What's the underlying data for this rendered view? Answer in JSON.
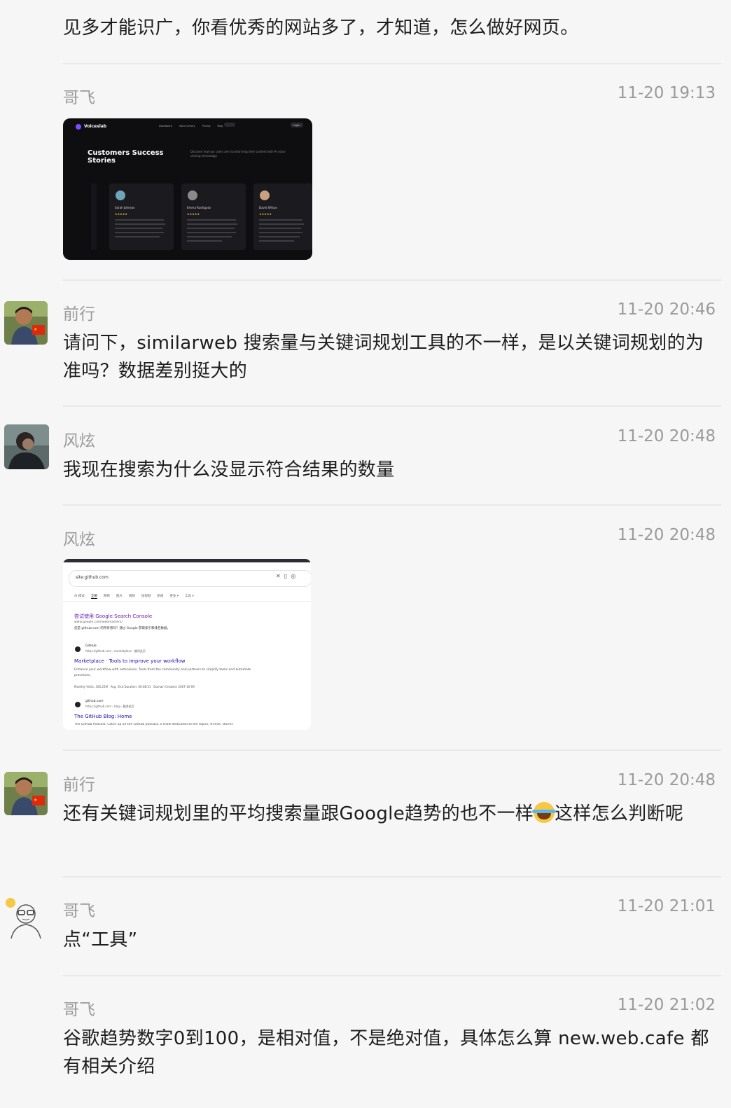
{
  "messages": [
    {
      "text": "见多才能识广，你看优秀的网站多了，才知道，怎么做好网页。"
    },
    {
      "sender": "哥飞",
      "time": "11-20 19:13",
      "image": {
        "brand": "Voiceslab",
        "nav": [
          "Dashboard",
          "Voice Library",
          "Pricing",
          "Blog"
        ],
        "login": "Login",
        "heading": "Customers Success Stories",
        "subtext": "Discover how our users are transforming their content with AI voice cloning technology",
        "cards": [
          {
            "name": "Sarah Johnson"
          },
          {
            "name": "Emma Rodriguez"
          },
          {
            "name": "David Wilson"
          }
        ]
      }
    },
    {
      "sender": "前行",
      "time": "11-20 20:46",
      "text": "请问下，similarweb 搜索量与关键词规划工具的不一样，是以关键词规划的为准吗？数据差别挺大的"
    },
    {
      "sender": "风炫",
      "time": "11-20 20:48",
      "text": "我现在搜索为什么没显示符合结果的数量"
    },
    {
      "sender": "风炫",
      "time": "11-20 20:48",
      "image": {
        "query": "site:github.com",
        "tabs": [
          "AI 模式",
          "全部",
          "网络",
          "图片",
          "视频",
          "短视频",
          "新闻",
          "更多 ▾",
          "工具 ▾"
        ],
        "active_tab": "全部",
        "r1_title": "尝试使用 Google Search Console",
        "r1_url": "www.google.com/webmasters/",
        "r1_desc": "您是 github.com 的所有者吗？通过 Google 获取索引和排名数据。",
        "r2_site": "GitHub",
        "r2_url": "https://github.com › marketplace · 翻译此页",
        "r2_title": "Marketplace · Tools to improve your workflow",
        "r2_desc": "Enhance your workflow with extensions. Tools from the community and partners to simplify tasks and automate processes.",
        "r2_stats": "Monthly Visits: 300.25M   Avg. Visit Duration: 00:08:31   Domain Created: 2007-10-09",
        "r3_site": "github.com",
        "r3_url": "https://github.com › blog · 翻译此页",
        "r3_title": "The GitHub Blog: Home",
        "r3_desc": "The GitHub Podcast. Catch up on the GitHub podcast, a show dedicated to the topics, trends, stories"
      }
    },
    {
      "sender": "前行",
      "time": "11-20 20:48",
      "text_a": "还有关键词规划里的平均搜索量跟Google趋势的也不一样",
      "text_b": "这样怎么判断呢"
    },
    {
      "sender": "哥飞",
      "time": "11-20 21:01",
      "text": "点“工具”"
    },
    {
      "sender": "哥飞",
      "time": "11-20 21:02",
      "text": "谷歌趋势数字0到100，是相对值，不是绝对值，具体怎么算 new.web.cafe 都有相关介绍"
    }
  ]
}
